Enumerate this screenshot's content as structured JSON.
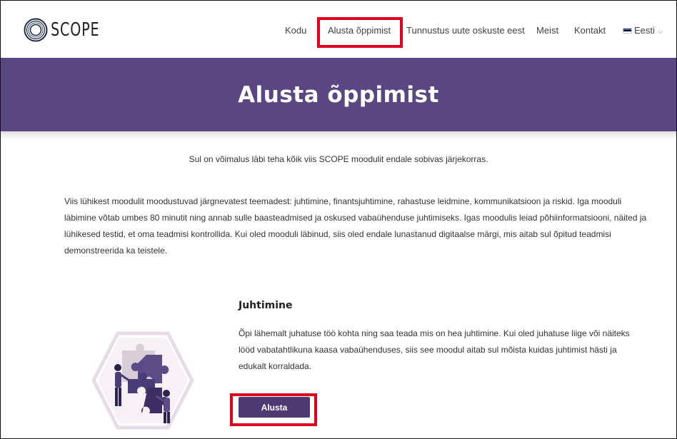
{
  "logo": {
    "text": "SCOPE"
  },
  "nav": {
    "items": [
      "Kodu",
      "Alusta õppimist",
      "Tunnustus uute oskuste eest",
      "Meist",
      "Kontakt"
    ],
    "language": "Eesti"
  },
  "banner": {
    "title": "Alusta õppimist"
  },
  "intro": "Sul on võimalus läbi teha kõik viis SCOPE moodulit endale sobivas järjekorras.",
  "description": "Viis lühikest moodulit moodustuvad järgnevatest teemadest: juhtimine, finantsjuhtimine, rahastuse leidmine, kommunikatsioon ja riskid. Iga mooduli läbimine võtab umbes 80 minutit ning annab sulle baasteadmised ja oskused vabaühenduse juhtimiseks. Igas moodulis leiad põhiinformatsiooni, näited ja lühikesed testid, et oma teadmisi kontrollida. Kui oled mooduli läbinud, siis oled endale lunastanud digitaalse märgi, mis aitab sul õpitud teadmisi demonstreerida ka teistele.",
  "module": {
    "title": "Juhtimine",
    "text": "Õpi lähemalt juhatuse töö kohta ning saa teada mis on hea juhtimine. Kui oled juhatuse liige või näiteks lööd vabatahtlikuna kaasa vabaühenduses, siis see moodul aitab sul mõista kuidas juhtimist hästi ja edukalt korraldada.",
    "button": "Alusta"
  },
  "colors": {
    "banner": "#594683",
    "button": "#4f3a73",
    "highlight": "#e0001b"
  }
}
